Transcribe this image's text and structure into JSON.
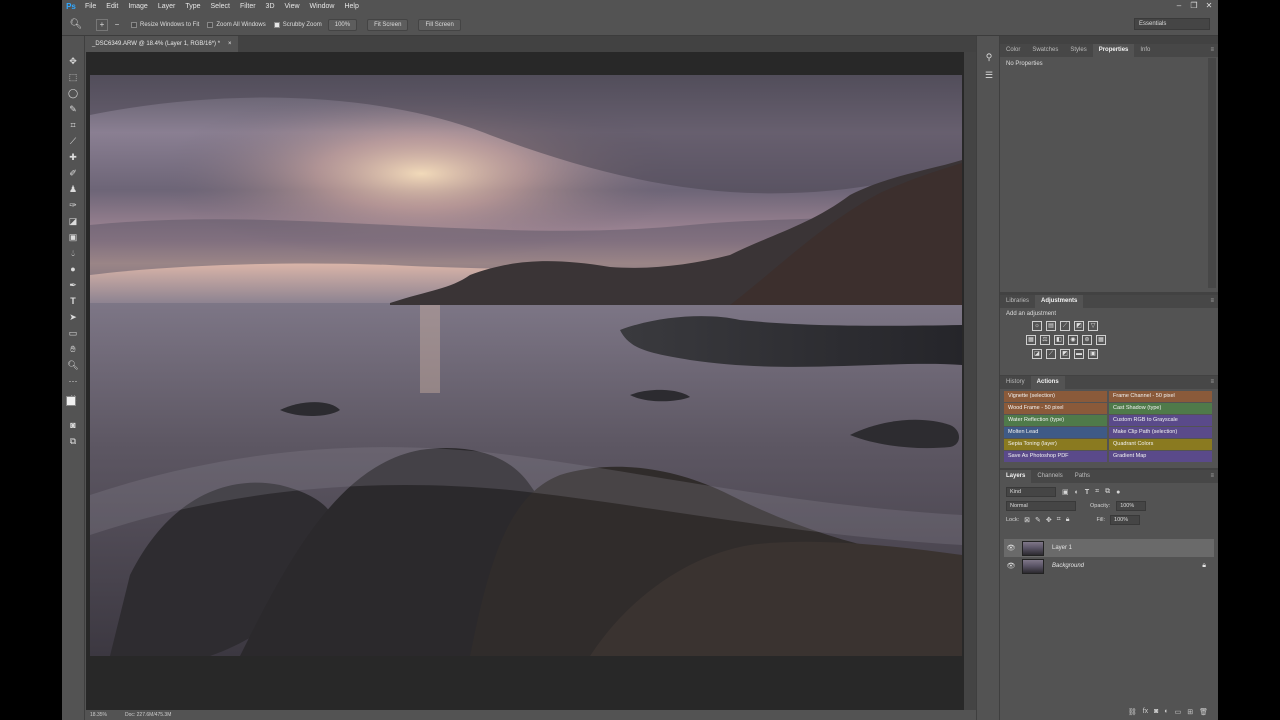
{
  "app": {
    "logo": "Ps"
  },
  "menu": [
    "File",
    "Edit",
    "Image",
    "Layer",
    "Type",
    "Select",
    "Filter",
    "3D",
    "View",
    "Window",
    "Help"
  ],
  "window_controls": [
    "minimize-icon",
    "restore-icon",
    "close-icon"
  ],
  "options_bar": {
    "resize_windows": "Resize Windows to Fit",
    "zoom_all": "Zoom All Windows",
    "scrubby_zoom": "Scrubby Zoom",
    "btn_100": "100%",
    "fit_screen": "Fit Screen",
    "fill_screen": "Fill Screen",
    "workspace": "Essentials"
  },
  "document": {
    "tab_title": "_DSC6349.ARW @ 18.4% (Layer 1, RGB/16*) *",
    "tab_close": "×"
  },
  "status": {
    "zoom": "18.35%",
    "doc": "Doc: 227.6M/475.3M"
  },
  "panels": {
    "top_tabs": [
      "Color",
      "Swatches",
      "Styles",
      "Properties",
      "Info"
    ],
    "top_active": "Properties",
    "properties_text": "No Properties",
    "adj_tabs": [
      "Libraries",
      "Adjustments"
    ],
    "adj_active": "Adjustments",
    "add_adjustment": "Add an adjustment",
    "hist_tabs": [
      "History",
      "Actions"
    ],
    "hist_active": "Actions",
    "actions": [
      {
        "label": "Vignette (selection)",
        "color": "#8a5a3a"
      },
      {
        "label": "Frame Channel - 50 pixel",
        "color": "#8a5a3a"
      },
      {
        "label": "Wood Frame - 50 pixel",
        "color": "#8a5a3a"
      },
      {
        "label": "Cast Shadow (type)",
        "color": "#4f7a4a"
      },
      {
        "label": "Water Reflection (type)",
        "color": "#4f7a4a"
      },
      {
        "label": "Custom RGB to Grayscale",
        "color": "#5a4a8a"
      },
      {
        "label": "Molten Lead",
        "color": "#3f5a86"
      },
      {
        "label": "Make Clip Path (selection)",
        "color": "#5a4a8a"
      },
      {
        "label": "Sepia Toning (layer)",
        "color": "#8a7a20"
      },
      {
        "label": "Quadrant Colors",
        "color": "#8a7a20"
      },
      {
        "label": "Save As Photoshop PDF",
        "color": "#5a4a8a"
      },
      {
        "label": "Gradient Map",
        "color": "#5a4a8a"
      }
    ],
    "layer_tabs": [
      "Layers",
      "Channels",
      "Paths"
    ],
    "layer_active": "Layers",
    "kind": "Kind",
    "blend_mode": "Normal",
    "opacity_label": "Opacity:",
    "opacity": "100%",
    "lock_label": "Lock:",
    "fill_label": "Fill:",
    "fill": "100%",
    "layers": [
      {
        "name": "Layer 1",
        "selected": true
      },
      {
        "name": "Background",
        "selected": false
      }
    ]
  }
}
